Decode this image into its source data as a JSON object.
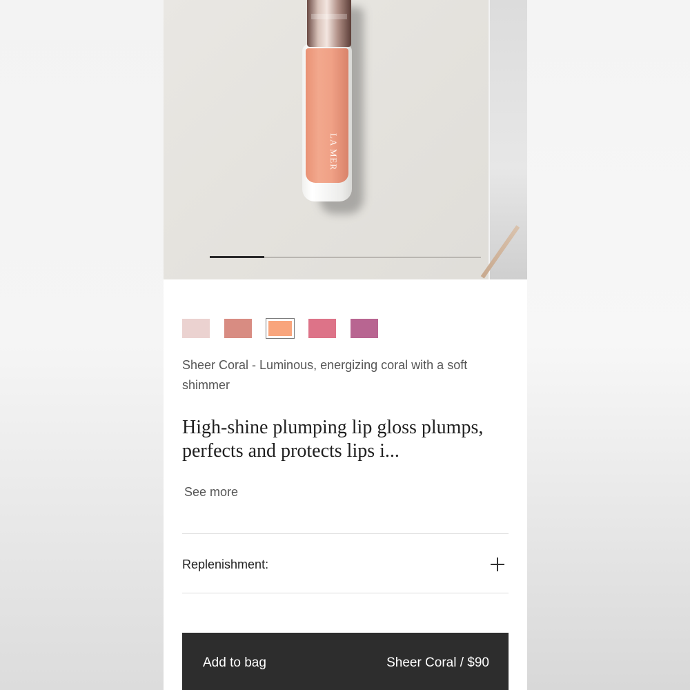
{
  "product": {
    "brand_mark": "LA MER",
    "shade_description": "Sheer Coral - Luminous, energizing coral with a soft shimmer",
    "headline": "High-shine plumping lip gloss plumps, perfects and protects lips i...",
    "see_more_label": "See more"
  },
  "gallery": {
    "current_slide": 1,
    "slide_count": 5
  },
  "swatches": [
    {
      "color": "#ebd2d0",
      "selected": false
    },
    {
      "color": "#d88c82",
      "selected": false
    },
    {
      "color": "#f9a57c",
      "selected": true
    },
    {
      "color": "#dd7388",
      "selected": false
    },
    {
      "color": "#b86591",
      "selected": false
    }
  ],
  "replenishment": {
    "label": "Replenishment:",
    "icon": "plus-icon"
  },
  "cart": {
    "add_label": "Add to bag",
    "selection_price": "Sheer Coral / $90"
  }
}
